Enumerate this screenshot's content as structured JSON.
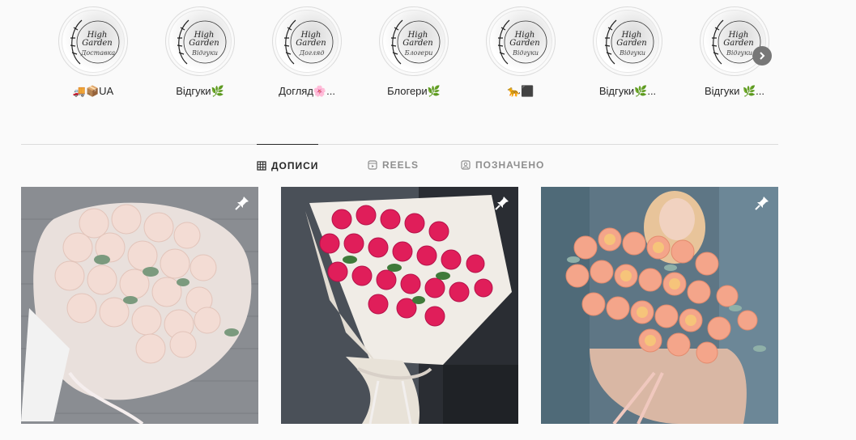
{
  "highlights": [
    {
      "label": "🚚📦UA",
      "sub": "Доставка"
    },
    {
      "label": "Відгуки🌿",
      "sub": "Відгуки"
    },
    {
      "label": "Догляд🌸...",
      "sub": "Догляд"
    },
    {
      "label": "Блогери🌿",
      "sub": "Блогери"
    },
    {
      "label": "🐆⬛",
      "sub": "Відгуки"
    },
    {
      "label": "Відгуки🌿...",
      "sub": "Відгуки"
    },
    {
      "label": "Відгуки 🌿...",
      "sub": "Відгуки"
    }
  ],
  "logo_text": "High Garden",
  "next_icon": "chevron-right-icon",
  "tabs": [
    {
      "label": "ДОПИСИ",
      "icon": "grid-icon",
      "active": true
    },
    {
      "label": "REELS",
      "icon": "reels-icon",
      "active": false
    },
    {
      "label": "ПОЗНАЧЕНО",
      "icon": "tagged-icon",
      "active": false
    }
  ],
  "posts": [
    {
      "name": "white-pink-roses-bouquet",
      "pinned": true,
      "flower_color": "#f3dcd4",
      "bg": "#8a8d92"
    },
    {
      "name": "hot-pink-roses-bouquet",
      "pinned": true,
      "flower_color": "#e01e5a",
      "bg": "#2a2d33"
    },
    {
      "name": "peach-peony-roses-box",
      "pinned": true,
      "flower_color": "#f4a58a",
      "bg": "#4f6a78"
    }
  ]
}
